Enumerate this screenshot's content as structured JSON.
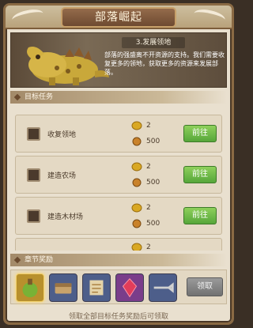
{
  "header": {
    "title": "部落崛起",
    "close_label": "✕"
  },
  "banner": {
    "title": "3.发展领地",
    "description": "部落的强盛离不开资源的支持。我们需要收复更多的领地，获取更多的资源来发展部落。"
  },
  "sections": {
    "goals": "目标任务",
    "chapter_rewards": "章节奖励"
  },
  "tasks": [
    {
      "name": "收复领地",
      "reward1": "2",
      "reward2": "500",
      "button": "前往"
    },
    {
      "name": "建造农场",
      "reward1": "2",
      "reward2": "500",
      "button": "前往"
    },
    {
      "name": "建造木材场",
      "reward1": "2",
      "reward2": "500",
      "button": "前往"
    },
    {
      "name": "",
      "reward1": "2",
      "reward2": "",
      "button": ""
    }
  ],
  "rewards": {
    "items": [
      "potion-icon",
      "chest-icon",
      "scroll-icon",
      "gem-icon",
      "weapon-icon"
    ],
    "claim_label": "领取"
  },
  "footer": {
    "note": "领取全部目标任务奖励后可领取"
  },
  "colors": {
    "accent_green": "#56a63a",
    "frame_brown": "#8a6a44",
    "panel_bg": "#e9e0cf"
  }
}
